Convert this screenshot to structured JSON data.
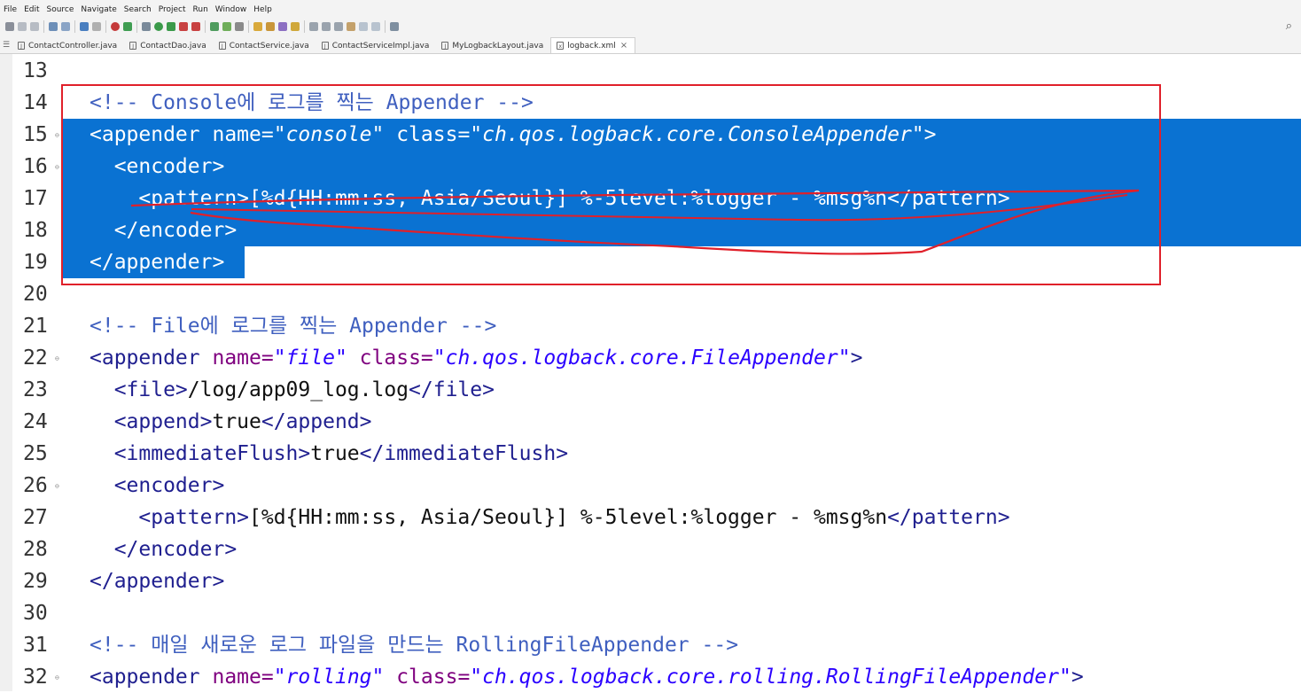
{
  "menu": [
    "File",
    "Edit",
    "Source",
    "Navigate",
    "Search",
    "Project",
    "Run",
    "Window",
    "Help"
  ],
  "toolbar": {
    "search_icon": "search-icon"
  },
  "tabs": [
    {
      "label": "ContactController.java",
      "icon": "java-file-icon"
    },
    {
      "label": "ContactDao.java",
      "icon": "java-file-icon"
    },
    {
      "label": "ContactService.java",
      "icon": "java-file-icon"
    },
    {
      "label": "ContactServiceImpl.java",
      "icon": "java-file-icon"
    },
    {
      "label": "MyLogbackLayout.java",
      "icon": "java-file-icon"
    },
    {
      "label": "logback.xml",
      "icon": "xml-file-icon",
      "active": true
    }
  ],
  "editor": {
    "lines": [
      {
        "n": "13",
        "fold": false,
        "sel": false,
        "parts": []
      },
      {
        "n": "14",
        "fold": false,
        "sel": false,
        "parts": [
          [
            "c",
            "<!-- Console에 로그를 찍는 Appender -->"
          ]
        ]
      },
      {
        "n": "15",
        "fold": true,
        "sel": true,
        "parts": [
          [
            "t",
            "<appender "
          ],
          [
            "a",
            "name="
          ],
          [
            "v",
            "\"console\""
          ],
          [
            "a",
            " class="
          ],
          [
            "v",
            "\"ch.qos.logback.core.ConsoleAppender\""
          ],
          [
            "t",
            ">"
          ]
        ]
      },
      {
        "n": "16",
        "fold": true,
        "sel": true,
        "parts": [
          [
            "t",
            "  <encoder>"
          ]
        ]
      },
      {
        "n": "17",
        "fold": false,
        "sel": true,
        "parts": [
          [
            "t",
            "    <pattern>"
          ],
          [
            "x",
            "[%d{HH:mm:ss, Asia/Seoul}] %-5level:%logger - %msg%n"
          ],
          [
            "t",
            "</pattern>"
          ]
        ]
      },
      {
        "n": "18",
        "fold": false,
        "sel": true,
        "parts": [
          [
            "t",
            "  </encoder>"
          ]
        ]
      },
      {
        "n": "19",
        "fold": false,
        "sel": true,
        "parts": [
          [
            "t",
            "</appender>"
          ]
        ]
      },
      {
        "n": "20",
        "fold": false,
        "sel": false,
        "parts": []
      },
      {
        "n": "21",
        "fold": false,
        "sel": false,
        "parts": [
          [
            "c",
            "<!-- File에 로그를 찍는 Appender -->"
          ]
        ]
      },
      {
        "n": "22",
        "fold": true,
        "sel": false,
        "parts": [
          [
            "t",
            "<appender "
          ],
          [
            "a",
            "name="
          ],
          [
            "v",
            "\"file\""
          ],
          [
            "a",
            " class="
          ],
          [
            "v",
            "\"ch.qos.logback.core.FileAppender\""
          ],
          [
            "t",
            ">"
          ]
        ]
      },
      {
        "n": "23",
        "fold": false,
        "sel": false,
        "parts": [
          [
            "t",
            "  <file>"
          ],
          [
            "x",
            "/log/app09_log.log"
          ],
          [
            "t",
            "</file>"
          ]
        ]
      },
      {
        "n": "24",
        "fold": false,
        "sel": false,
        "parts": [
          [
            "t",
            "  <append>"
          ],
          [
            "x",
            "true"
          ],
          [
            "t",
            "</append>"
          ]
        ]
      },
      {
        "n": "25",
        "fold": false,
        "sel": false,
        "parts": [
          [
            "t",
            "  <immediateFlush>"
          ],
          [
            "x",
            "true"
          ],
          [
            "t",
            "</immediateFlush>"
          ]
        ]
      },
      {
        "n": "26",
        "fold": true,
        "sel": false,
        "parts": [
          [
            "t",
            "  <encoder>"
          ]
        ]
      },
      {
        "n": "27",
        "fold": false,
        "sel": false,
        "parts": [
          [
            "t",
            "    <pattern>"
          ],
          [
            "x",
            "[%d{HH:mm:ss, Asia/Seoul}] %-5level:%logger - %msg%n"
          ],
          [
            "t",
            "</pattern>"
          ]
        ]
      },
      {
        "n": "28",
        "fold": false,
        "sel": false,
        "parts": [
          [
            "t",
            "  </encoder>"
          ]
        ]
      },
      {
        "n": "29",
        "fold": false,
        "sel": false,
        "parts": [
          [
            "t",
            "</appender>"
          ]
        ]
      },
      {
        "n": "30",
        "fold": false,
        "sel": false,
        "parts": []
      },
      {
        "n": "31",
        "fold": false,
        "sel": false,
        "parts": [
          [
            "c",
            "<!-- 매일 새로운 로그 파일을 만드는 RollingFileAppender -->"
          ]
        ]
      },
      {
        "n": "32",
        "fold": true,
        "sel": false,
        "parts": [
          [
            "t",
            "<appender "
          ],
          [
            "a",
            "name="
          ],
          [
            "v",
            "\"rolling\""
          ],
          [
            "a",
            " class="
          ],
          [
            "v",
            "\"ch.qos.logback.core.rolling.RollingFileAppender\""
          ],
          [
            "t",
            ">"
          ]
        ]
      }
    ]
  },
  "colors": {
    "selection": "#0a72d2",
    "annotation": "#e0202a"
  }
}
